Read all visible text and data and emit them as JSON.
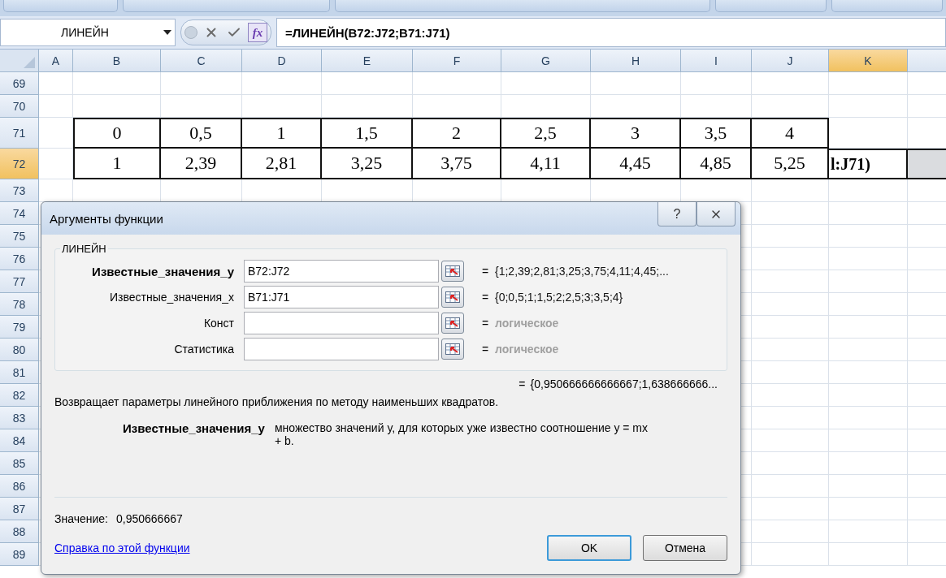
{
  "formula_bar": {
    "name_box": "ЛИНЕЙН",
    "fx_label": "fx",
    "formula": "=ЛИНЕЙН(B72:J72;B71:J71)"
  },
  "columns": [
    {
      "label": "A",
      "selected": false
    },
    {
      "label": "B",
      "selected": false
    },
    {
      "label": "C",
      "selected": false
    },
    {
      "label": "D",
      "selected": false
    },
    {
      "label": "E",
      "selected": false
    },
    {
      "label": "F",
      "selected": false
    },
    {
      "label": "G",
      "selected": false
    },
    {
      "label": "H",
      "selected": false
    },
    {
      "label": "I",
      "selected": false
    },
    {
      "label": "J",
      "selected": false
    },
    {
      "label": "K",
      "selected": true
    }
  ],
  "rows": [
    {
      "number": "69",
      "selected": false
    },
    {
      "number": "70",
      "selected": false
    },
    {
      "number": "71",
      "selected": false,
      "values": [
        "0",
        "0,5",
        "1",
        "1,5",
        "2",
        "2,5",
        "3",
        "3,5",
        "4"
      ]
    },
    {
      "number": "72",
      "selected": true,
      "values": [
        "1",
        "2,39",
        "2,81",
        "3,25",
        "3,75",
        "4,11",
        "4,45",
        "4,85",
        "5,25"
      ],
      "active_cell_text": "l:J71)"
    },
    {
      "number": "73",
      "selected": false
    },
    {
      "number": "74",
      "selected": false
    },
    {
      "number": "75",
      "selected": false
    },
    {
      "number": "76",
      "selected": false
    },
    {
      "number": "77",
      "selected": false
    },
    {
      "number": "78",
      "selected": false
    },
    {
      "number": "79",
      "selected": false
    },
    {
      "number": "80",
      "selected": false
    },
    {
      "number": "81",
      "selected": false
    },
    {
      "number": "82",
      "selected": false
    },
    {
      "number": "83",
      "selected": false
    },
    {
      "number": "84",
      "selected": false
    },
    {
      "number": "85",
      "selected": false
    },
    {
      "number": "86",
      "selected": false
    },
    {
      "number": "87",
      "selected": false
    },
    {
      "number": "88",
      "selected": false
    },
    {
      "number": "89",
      "selected": false
    }
  ],
  "dialog": {
    "title": "Аргументы функции",
    "help_label": "?",
    "function_name": "ЛИНЕЙН",
    "arguments": [
      {
        "label": "Известные_значения_y",
        "value": "B72:J72",
        "result": "{1;2,39;2,81;3,25;3,75;4,11;4,45;...",
        "disabled": false,
        "selected": true
      },
      {
        "label": "Известные_значения_x",
        "value": "B71:J71",
        "result": "{0;0,5;1;1,5;2;2,5;3;3,5;4}",
        "disabled": false,
        "selected": false
      },
      {
        "label": "Конст",
        "result": "логическое",
        "disabled": true,
        "selected": false
      },
      {
        "label": "Статистика",
        "result": "логическое",
        "disabled": true,
        "selected": false
      }
    ],
    "equals": "=",
    "formula_result": "{0,950666666666667;1,638666666...",
    "description": "Возвращает параметры линейного приближения по методу наименьших квадратов.",
    "arg_help": {
      "name": "Известные_значения_y",
      "text": "множество значений y, для которых уже известно соотношение y = mx + b."
    },
    "value_label": "Значение:",
    "value": "0,950666667",
    "help_link": "Справка по этой функции",
    "buttons": [
      {
        "label": "OK",
        "default": true
      },
      {
        "label": "Отмена",
        "default": false
      }
    ]
  }
}
